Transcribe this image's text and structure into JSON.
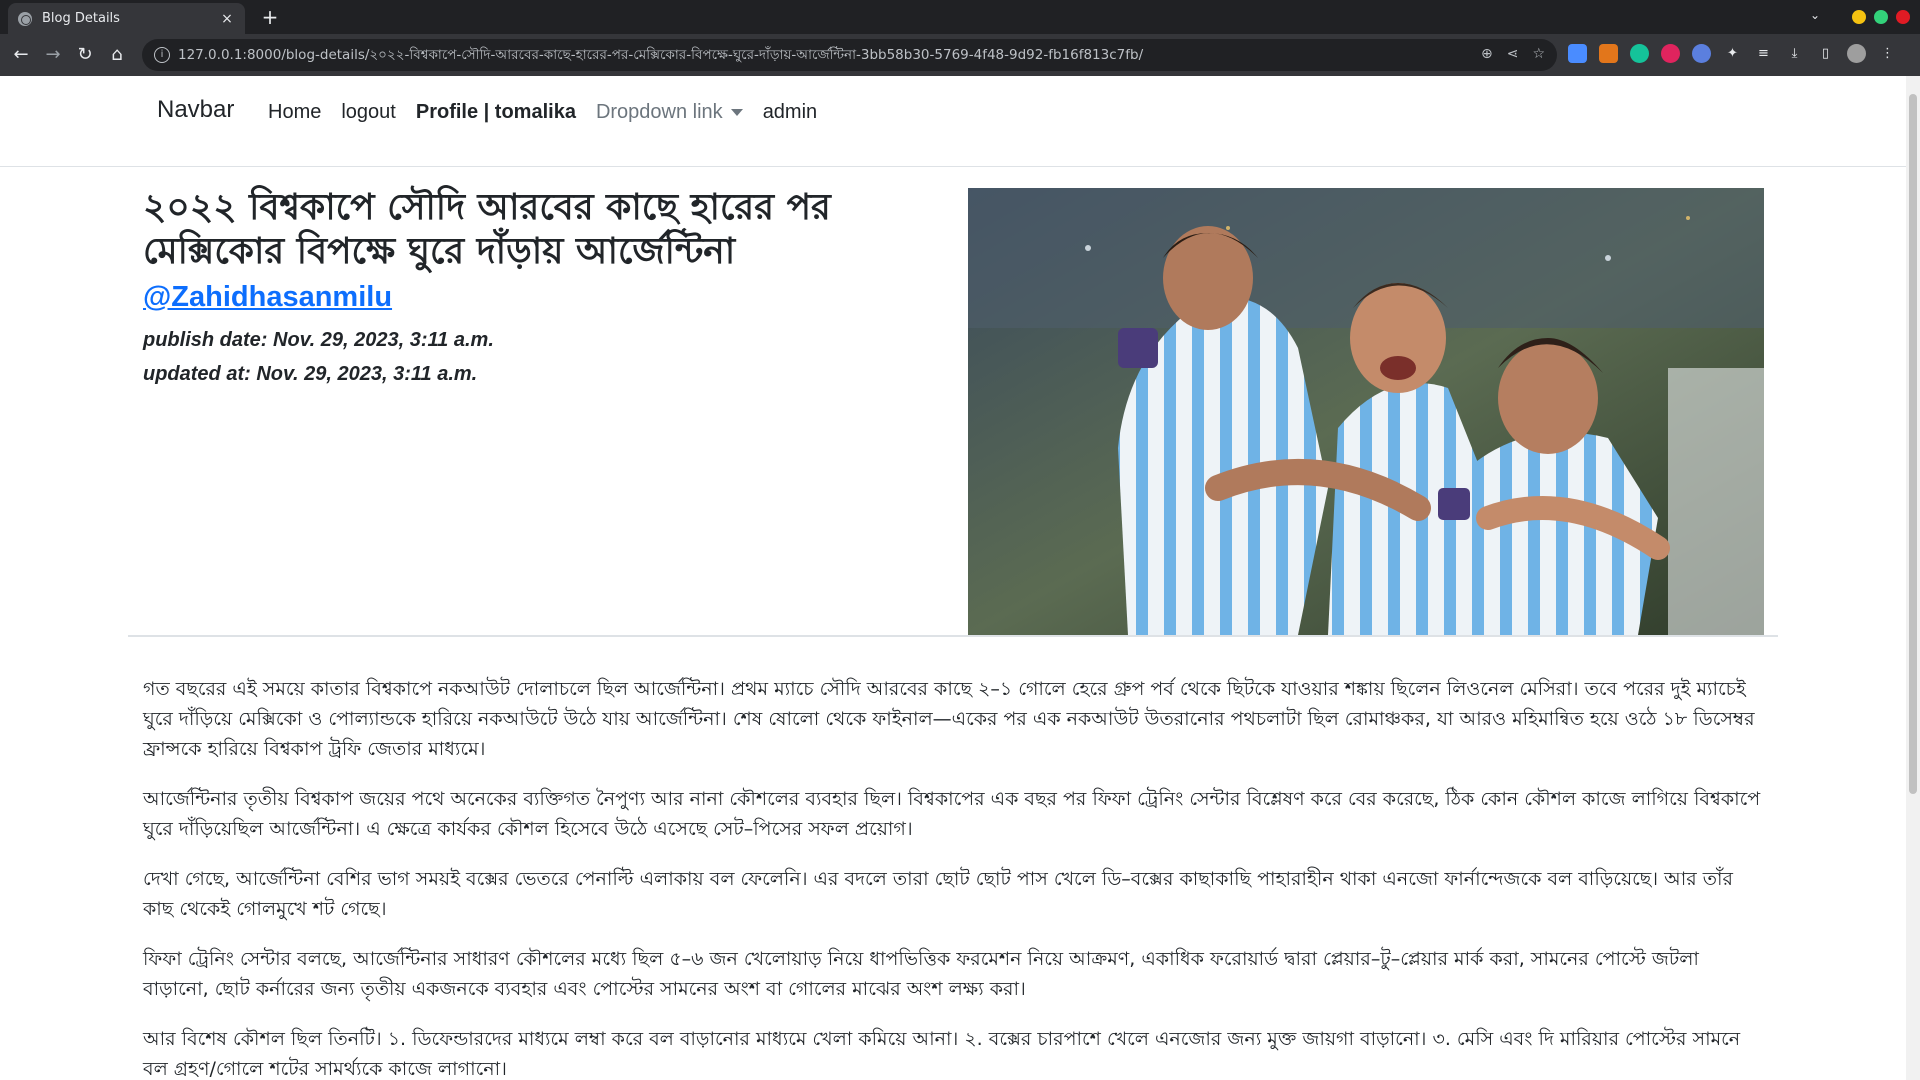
{
  "browser": {
    "tab_title": "Blog Details",
    "tab_close": "×",
    "new_tab": "+",
    "url": "127.0.0.1:8000/blog-details/২০২২-বিশ্বকাপে-সৌদি-আরবের-কাছে-হারের-পর-মেক্সিকোর-বিপক্ষে-ঘুরে-দাঁড়ায়-আর্জেন্টিনা-3bb58b30-5769-4f48-9d92-fb16f813c7fb/"
  },
  "navbar": {
    "brand": "Navbar",
    "links": [
      "Home",
      "logout",
      "Profile | tomalika",
      "Dropdown link",
      "admin"
    ]
  },
  "post": {
    "title": "২০২২ বিশ্বকাপে সৌদি আরবের কাছে হারের পর মেক্সিকোর বিপক্ষে ঘুরে দাঁড়ায় আর্জেন্টিনা",
    "author": "@Zahidhasanmilu",
    "publish_date": "publish date: Nov. 29, 2023, 3:11 a.m.",
    "updated_at": "updated at: Nov. 29, 2023, 3:11 a.m.",
    "paragraphs": [
      "গত বছরের এই সময়ে কাতার বিশ্বকাপে নকআউট দোলাচলে ছিল আর্জেন্টিনা। প্রথম ম্যাচে সৌদি আরবের কাছে ২–১ গোলে হেরে গ্রুপ পর্ব থেকে ছিটকে যাওয়ার শঙ্কায় ছিলেন লিওনেল মেসিরা। তবে পরের দুই ম্যাচেই ঘুরে দাঁড়িয়ে মেক্সিকো ও পোল্যান্ডকে হারিয়ে নকআউটে উঠে যায় আর্জেন্টিনা। শেষ ষোলো থেকে ফাইনাল—একের পর এক নকআউট উতরানোর পথচলাটা ছিল রোমাঞ্চকর, যা আরও মহিমান্বিত হয়ে ওঠে ১৮ ডিসেম্বর ফ্রান্সকে হারিয়ে বিশ্বকাপ ট্রফি জেতার মাধ্যমে।",
      "আর্জেন্টিনার তৃতীয় বিশ্বকাপ জয়ের পথে অনেকের ব্যক্তিগত নৈপুণ্য আর নানা কৌশলের ব্যবহার ছিল। বিশ্বকাপের এক বছর পর ফিফা ট্রেনিং সেন্টার বিশ্লেষণ করে বের করেছে, ঠিক কোন কৌশল কাজে লাগিয়ে বিশ্বকাপে ঘুরে দাঁড়িয়েছিল আর্জেন্টিনা। এ ক্ষেত্রে কার্যকর কৌশল হিসেবে উঠে এসেছে সেট–পিসের সফল প্রয়োগ।",
      "দেখা গেছে, আর্জেন্টিনা বেশির ভাগ সময়ই বক্সের ভেতরে পেনাল্টি এলাকায় বল ফেলেনি। এর বদলে তারা ছোট ছোট পাস খেলে ডি–বক্সের কাছাকাছি পাহারাহীন থাকা এনজো ফার্নান্দেজকে বল বাড়িয়েছে। আর তাঁর কাছ থেকেই গোলমুখে শট গেছে।",
      "ফিফা ট্রেনিং সেন্টার বলছে, আর্জেন্টিনার সাধারণ কৌশলের মধ্যে ছিল ৫–৬ জন খেলোয়াড় নিয়ে ধাপভিত্তিক ফরমেশন নিয়ে আক্রমণ, একাধিক ফরোয়ার্ড দ্বারা প্লেয়ার–টু–প্লেয়ার মার্ক করা, সামনের পোস্টে জটলা বাড়ানো, ছোট কর্নারের জন্য তৃতীয় একজনকে ব্যবহার এবং পোস্টের সামনের অংশ বা গোলের মাঝের অংশ লক্ষ্য করা।",
      "আর বিশেষ কৌশল ছিল তিনটি। ১. ডিফেন্ডারদের মাধ্যমে লম্বা করে বল বাড়ানোর মাধ্যমে খেলা কমিয়ে আনা। ২. বক্সের চারপাশে খেলে এনজোর জন্য মুক্ত জায়গা বাড়ানো। ৩. মেসি এবং দি মারিয়ার পোস্টের সামনে বল গ্রহণ/গোলে শটের সামর্থ্যকে কাজে লাগানো।"
    ]
  },
  "colors": {
    "link": "#0d6efd",
    "text": "#212529",
    "muted": "#6c757d"
  }
}
